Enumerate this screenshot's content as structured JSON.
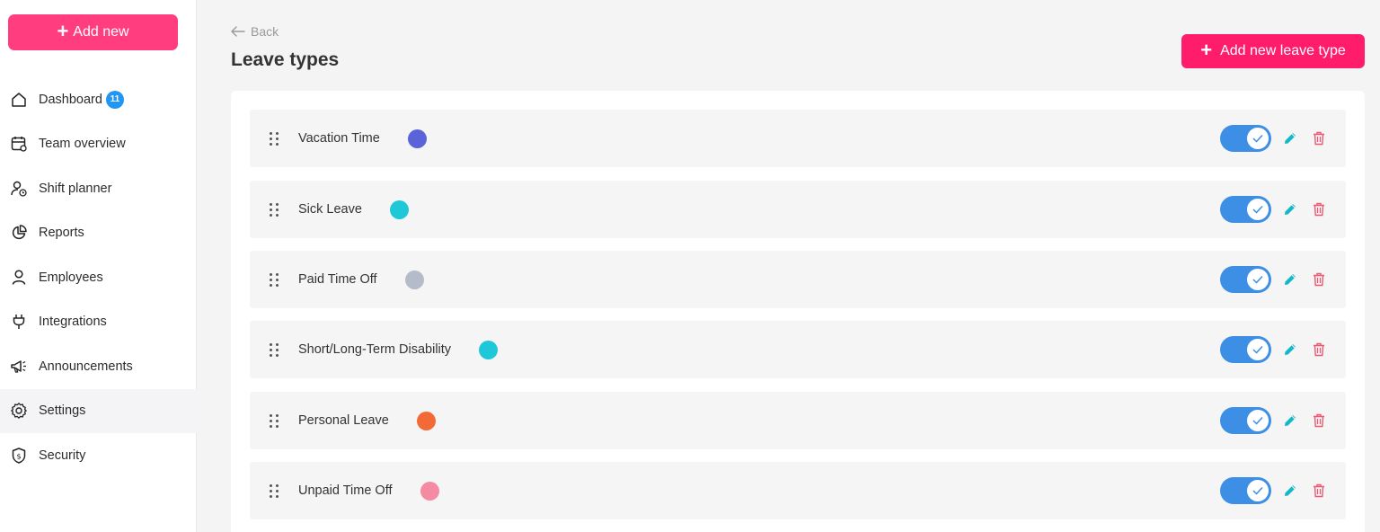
{
  "sidebar": {
    "add_new_label": "Add new",
    "items": [
      {
        "label": "Dashboard",
        "icon": "home-icon",
        "badge": "11"
      },
      {
        "label": "Team overview",
        "icon": "calendar-icon"
      },
      {
        "label": "Shift planner",
        "icon": "user-clock-icon"
      },
      {
        "label": "Reports",
        "icon": "pie-chart-icon"
      },
      {
        "label": "Employees",
        "icon": "user-icon"
      },
      {
        "label": "Integrations",
        "icon": "plug-icon"
      },
      {
        "label": "Announcements",
        "icon": "megaphone-icon"
      },
      {
        "label": "Settings",
        "icon": "gear-icon",
        "active": true
      },
      {
        "label": "Security",
        "icon": "shield-icon"
      }
    ]
  },
  "header": {
    "back_label": "Back",
    "title": "Leave types",
    "add_type_label": "Add new leave type"
  },
  "leave_types": [
    {
      "name": "Vacation Time",
      "color": "#5a63d8",
      "enabled": true
    },
    {
      "name": "Sick Leave",
      "color": "#1fc8d8",
      "enabled": true
    },
    {
      "name": "Paid Time Off",
      "color": "#b3bcc8",
      "enabled": true
    },
    {
      "name": "Short/Long-Term Disability",
      "color": "#1fc8d8",
      "enabled": true
    },
    {
      "name": "Personal Leave",
      "color": "#f26b36",
      "enabled": true
    },
    {
      "name": "Unpaid Time Off",
      "color": "#f58aa3",
      "enabled": true
    }
  ],
  "colors": {
    "brand_pink": "#ff3d7f",
    "toggle_blue": "#3d8fe6",
    "edit_teal": "#10b8c8",
    "delete_red": "#f0566f",
    "badge_blue": "#2196f3"
  }
}
